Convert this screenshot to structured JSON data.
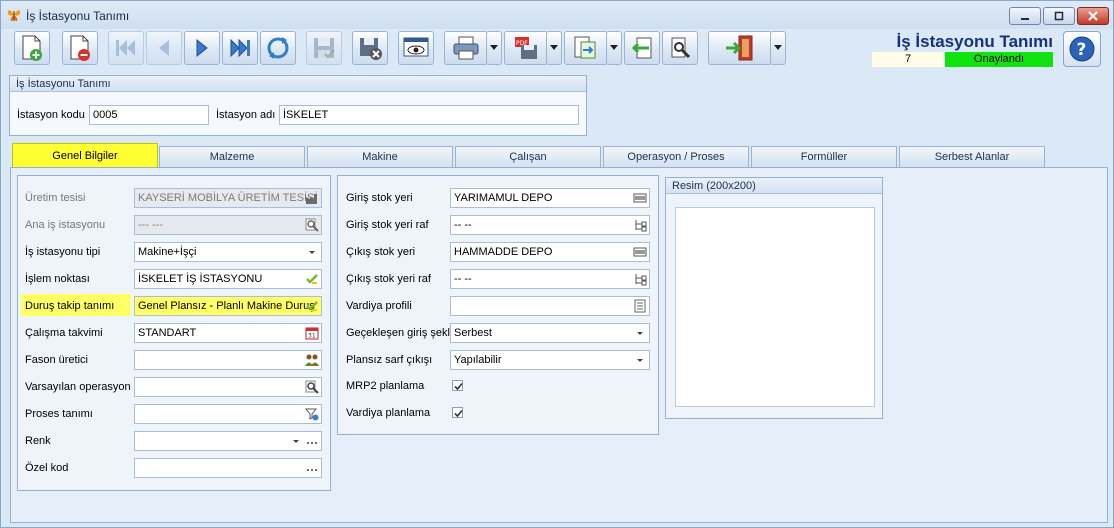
{
  "window": {
    "title": "İş İstasyonu Tanımı"
  },
  "header": {
    "form_title": "İş İstasyonu Tanımı",
    "record_number": "7",
    "status": "Onaylandı"
  },
  "colors": {
    "status_green": "#11e30f",
    "highlight_yellow": "#ffff66",
    "tab_active": "#ffff33"
  },
  "toolbar": {
    "icons": [
      "new-document-icon",
      "delete-document-icon",
      "first-record-icon",
      "previous-record-icon",
      "next-record-icon",
      "last-record-icon",
      "refresh-icon",
      "save-icon",
      "save-close-icon",
      "preview-icon",
      "print-icon",
      "pdf-export-icon",
      "export-icon",
      "import-icon",
      "tools-icon",
      "exit-icon",
      "help-icon"
    ]
  },
  "identity": {
    "group_title": "İş İstasyonu Tanımı",
    "code_label": "İstasyon kodu",
    "code_value": "0005",
    "name_label": "İstasyon adı",
    "name_value": "İSKELET"
  },
  "tabs": [
    {
      "label": "Genel Bilgiler"
    },
    {
      "label": "Malzeme"
    },
    {
      "label": "Makine"
    },
    {
      "label": "Çalışan"
    },
    {
      "label": "Operasyon / Proses"
    },
    {
      "label": "Formüller"
    },
    {
      "label": "Serbest Alanlar"
    }
  ],
  "left_panel": {
    "fields": [
      {
        "label": "Üretim tesisi",
        "value": "KAYSERİ MOBİLYA ÜRETİM TESİSİ",
        "icon": "factory-icon"
      },
      {
        "label": "Ana iş istasyonu",
        "value": "--- ---",
        "icon": "search-icon"
      },
      {
        "label": "İş istasyonu tipi",
        "value": "Makine+İşçi",
        "icon": "dropdown-arrow-icon"
      },
      {
        "label": "İşlem noktası",
        "value": "İSKELET İŞ İSTASYONU",
        "icon": "check-icon"
      },
      {
        "label": "Duruş takip tanımı",
        "value": "Genel Plansız - Planlı Makine Duruş",
        "icon": "check-icon"
      },
      {
        "label": "Çalışma takvimi",
        "value": "STANDART",
        "icon": "calendar-icon"
      },
      {
        "label": "Fason üretici",
        "value": "",
        "icon": "people-icon"
      },
      {
        "label": "Varsayılan operasyon",
        "value": "",
        "icon": "search-icon"
      },
      {
        "label": "Proses tanımı",
        "value": "",
        "icon": "process-icon"
      },
      {
        "label": "Renk",
        "value": "",
        "icon": "dropdown-arrow-icon"
      },
      {
        "label": "Özel kod",
        "value": "",
        "icon": "ellipsis-icon"
      }
    ]
  },
  "middle_panel": {
    "fields": [
      {
        "label": "Giriş stok yeri",
        "value": "YARIMAMUL DEPO",
        "icon": "lookup-icon"
      },
      {
        "label": "Giriş stok yeri raf",
        "value": "-- --",
        "icon": "tree-icon"
      },
      {
        "label": "Çıkış stok yeri",
        "value": "HAMMADDE DEPO",
        "icon": "lookup-icon"
      },
      {
        "label": "Çıkış stok yeri raf",
        "value": "-- --",
        "icon": "tree-icon"
      },
      {
        "label": "Vardiya profili",
        "value": "",
        "icon": "list-icon"
      },
      {
        "label": "Geçekleşen giriş şekli",
        "value": "Serbest",
        "icon": "dropdown-arrow-icon"
      },
      {
        "label": "Plansız sarf çıkışı",
        "value": "Yapılabilir",
        "icon": "dropdown-arrow-icon"
      }
    ],
    "checkboxes": [
      {
        "label": "MRP2 planlama",
        "checked": true
      },
      {
        "label": "Vardiya planlama",
        "checked": true
      }
    ]
  },
  "image_panel": {
    "title": "Resim (200x200)"
  }
}
